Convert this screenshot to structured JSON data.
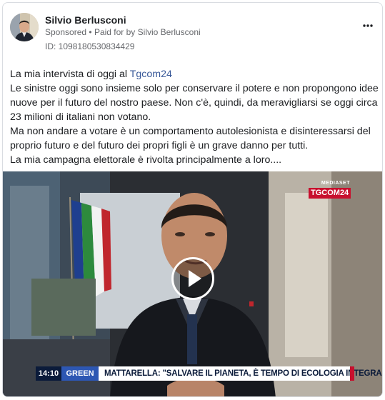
{
  "post": {
    "author": "Silvio Berlusconi",
    "sponsored_label": "Sponsored",
    "paid_by": "Paid for by Silvio Berlusconi",
    "id_label": "ID: 1098180530834429",
    "more_icon": "more-horizontal-icon"
  },
  "body": {
    "line1_prefix": "La mia intervista di oggi al ",
    "link": "Tgcom24",
    "line2": "Le sinistre oggi sono insieme solo per conservare il potere e non propongono idee",
    "line3": "nuove per il futuro del nostro paese. Non c'è, quindi, da meravigliarsi se oggi circa",
    "line4": "23 milioni di italiani non votano.",
    "line5": "Ma non andare a votare è un comportamento autolesionista e disinteressarsi del",
    "line6": "proprio futuro e del futuro dei propri figli è un grave danno per tutti.",
    "line7": "La mia campagna elettorale è rivolta principalmente a loro...."
  },
  "video": {
    "logo_top": "MEDIASET",
    "logo_main": "TGCOM24",
    "play_icon": "play-icon",
    "ticker_time": "14:10",
    "ticker_tag": "GREEN",
    "ticker_text": "MATTARELLA: \"SALVARE IL PIANETA, È TEMPO DI ECOLOGIA INTEGRALE\""
  },
  "colors": {
    "link": "#385898",
    "secondary_text": "#65676b",
    "tgcom_red": "#c8102e",
    "ticker_navy": "#0b1b3a",
    "ticker_blue": "#2d57b3"
  }
}
